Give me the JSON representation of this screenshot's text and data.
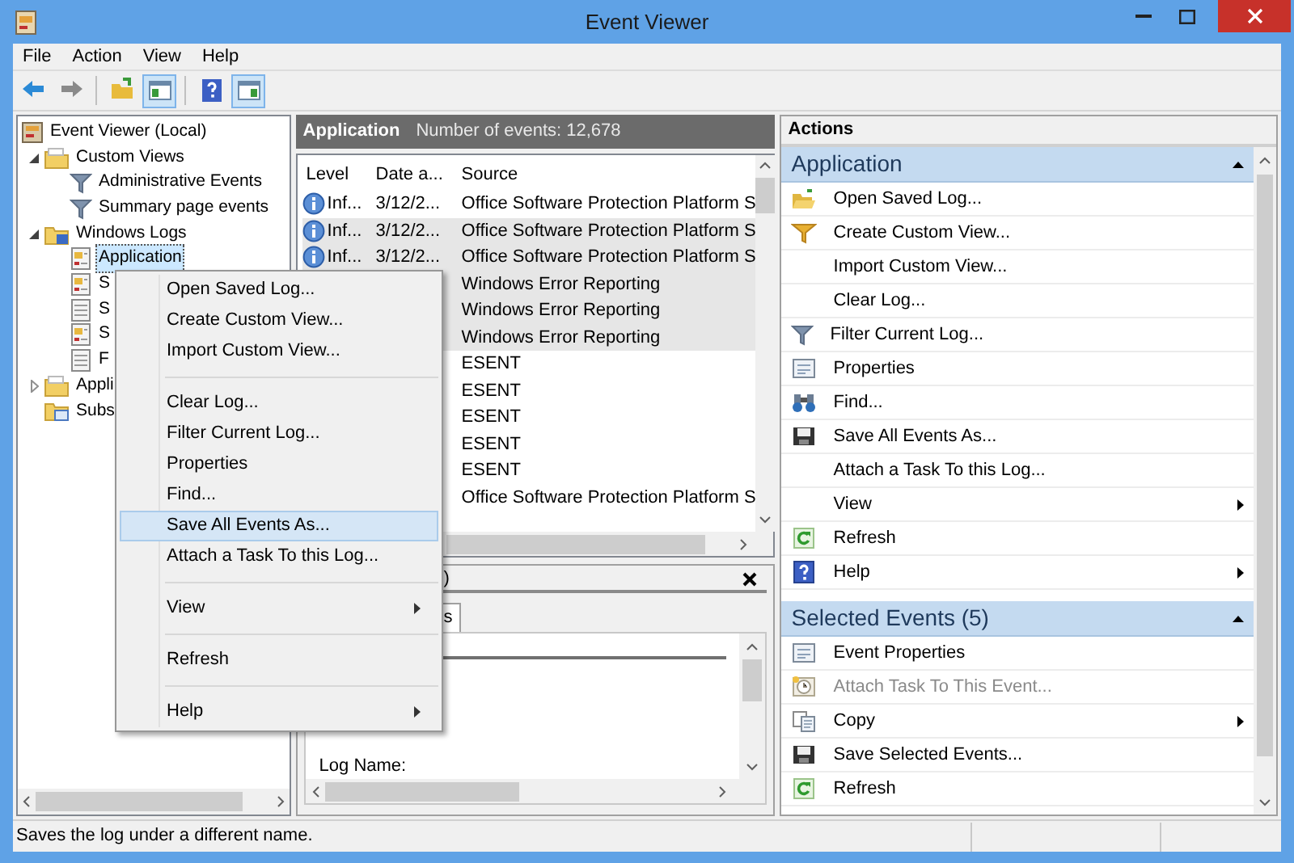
{
  "window": {
    "title": "Event Viewer"
  },
  "menu_bar": [
    "File",
    "Action",
    "View",
    "Help"
  ],
  "toolbar": [
    {
      "kind": "back",
      "pressed": false
    },
    {
      "kind": "forward",
      "pressed": false
    },
    {
      "kind": "separator"
    },
    {
      "kind": "up",
      "pressed": false
    },
    {
      "kind": "tree",
      "pressed": true
    },
    {
      "kind": "separator"
    },
    {
      "kind": "help",
      "pressed": false
    },
    {
      "kind": "actions",
      "pressed": true
    }
  ],
  "tree": [
    {
      "label": "Event Viewer (Local)",
      "kind": "viewer",
      "selected": false,
      "children": [
        {
          "label": "Custom Views",
          "kind": "folder",
          "expanded": true,
          "selected": false,
          "children": [
            {
              "label": "Administrative Events",
              "kind": "filter",
              "selected": false
            },
            {
              "label": "Summary page events",
              "kind": "filter",
              "selected": false
            }
          ]
        },
        {
          "label": "Windows Logs",
          "kind": "logs",
          "expanded": true,
          "selected": false,
          "children": [
            {
              "label": "Application",
              "kind": "log",
              "selected": true
            },
            {
              "label": "S",
              "kind": "log",
              "selected": false
            },
            {
              "label": "S",
              "kind": "page",
              "selected": false
            },
            {
              "label": "S",
              "kind": "log",
              "selected": false
            },
            {
              "label": "F",
              "kind": "page",
              "selected": false
            }
          ]
        },
        {
          "label": "Appli",
          "kind": "folder",
          "expanded": false,
          "selected": false
        },
        {
          "label": "Subs",
          "kind": "subs",
          "selected": false
        }
      ]
    }
  ],
  "events": {
    "title": "Application",
    "count": "Number of events: 12,678",
    "columns": [
      "Level",
      "Date a...",
      "Source"
    ],
    "rows": [
      {
        "level": "Inf...",
        "date": "3/12/2...",
        "source": "Office Software Protection Platform S",
        "selected": false
      },
      {
        "level": "Inf...",
        "date": "3/12/2...",
        "source": "Office Software Protection Platform S",
        "selected": true
      },
      {
        "level": "Inf...",
        "date": "3/12/2...",
        "source": "Office Software Protection Platform S",
        "selected": true
      },
      {
        "source": "Windows Error Reporting",
        "selected": true
      },
      {
        "source": "Windows Error Reporting",
        "selected": true
      },
      {
        "source": "Windows Error Reporting",
        "selected": true
      },
      {
        "source": "ESENT",
        "selected": false
      },
      {
        "source": "ESENT",
        "selected": false
      },
      {
        "source": "ESENT",
        "selected": false
      },
      {
        "source": "ESENT",
        "selected": false
      },
      {
        "source": "ESENT",
        "selected": false
      },
      {
        "source": "Office Software Protection Platform S",
        "selected": false
      }
    ]
  },
  "details": {
    "title": ")",
    "tab": "s",
    "field_label": "Log Name:"
  },
  "actions": {
    "title": "Actions",
    "sections": [
      {
        "title": "Application",
        "expanded": true,
        "items": [
          {
            "label": "Open Saved Log...",
            "kind": "open",
            "disabled": false,
            "submenu": false
          },
          {
            "label": "Create Custom View...",
            "kind": "create",
            "disabled": false,
            "submenu": false
          },
          {
            "label": "Import Custom View...",
            "kind": "none",
            "disabled": false,
            "submenu": false
          },
          {
            "label": "Clear Log...",
            "kind": "none",
            "disabled": false,
            "submenu": false
          },
          {
            "label": "Filter Current Log...",
            "kind": "filter",
            "disabled": false,
            "submenu": false
          },
          {
            "label": "Properties",
            "kind": "properties",
            "disabled": false,
            "submenu": false
          },
          {
            "label": "Find...",
            "kind": "find",
            "disabled": false,
            "submenu": false
          },
          {
            "label": "Save All Events As...",
            "kind": "save",
            "disabled": false,
            "submenu": false
          },
          {
            "label": "Attach a Task To this Log...",
            "kind": "none",
            "disabled": false,
            "submenu": false
          },
          {
            "label": "View",
            "kind": "none",
            "disabled": false,
            "submenu": true
          },
          {
            "label": "Refresh",
            "kind": "refresh",
            "disabled": false,
            "submenu": false
          },
          {
            "label": "Help",
            "kind": "help",
            "disabled": false,
            "submenu": true
          }
        ]
      },
      {
        "title": "Selected Events (5)",
        "expanded": true,
        "items": [
          {
            "label": "Event Properties",
            "kind": "properties",
            "disabled": false,
            "submenu": false
          },
          {
            "label": "Attach Task To This Event...",
            "kind": "attach",
            "disabled": true,
            "submenu": false
          },
          {
            "label": "Copy",
            "kind": "copy",
            "disabled": false,
            "submenu": true
          },
          {
            "label": "Save Selected Events...",
            "kind": "save",
            "disabled": false,
            "submenu": false
          },
          {
            "label": "Refresh",
            "kind": "refresh",
            "disabled": false,
            "submenu": false
          }
        ]
      }
    ]
  },
  "context_menu": {
    "items": [
      {
        "kind": "item",
        "label": "Open Saved Log...",
        "highlighted": false,
        "submenu": false
      },
      {
        "kind": "item",
        "label": "Create Custom View...",
        "highlighted": false,
        "submenu": false
      },
      {
        "kind": "item",
        "label": "Import Custom View...",
        "highlighted": false,
        "submenu": false
      },
      {
        "kind": "separator"
      },
      {
        "kind": "item",
        "label": "Clear Log...",
        "highlighted": false,
        "submenu": false
      },
      {
        "kind": "item",
        "label": "Filter Current Log...",
        "highlighted": false,
        "submenu": false
      },
      {
        "kind": "item",
        "label": "Properties",
        "highlighted": false,
        "submenu": false
      },
      {
        "kind": "item",
        "label": "Find...",
        "highlighted": false,
        "submenu": false
      },
      {
        "kind": "item",
        "label": "Save All Events As...",
        "highlighted": true,
        "submenu": false
      },
      {
        "kind": "item",
        "label": "Attach a Task To this Log...",
        "highlighted": false,
        "submenu": false
      },
      {
        "kind": "separator"
      },
      {
        "kind": "item",
        "label": "View",
        "highlighted": false,
        "submenu": true
      },
      {
        "kind": "separator"
      },
      {
        "kind": "item",
        "label": "Refresh",
        "highlighted": false,
        "submenu": false
      },
      {
        "kind": "separator"
      },
      {
        "kind": "item",
        "label": "Help",
        "highlighted": false,
        "submenu": true
      }
    ]
  },
  "status_bar": {
    "text": "Saves the log under a different name."
  }
}
